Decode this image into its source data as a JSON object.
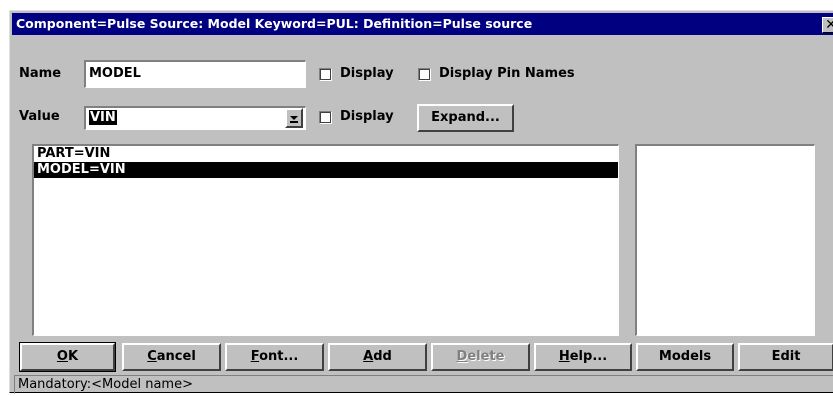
{
  "window": {
    "title": "Component=Pulse Source: Model Keyword=PUL: Definition=Pulse source",
    "close_glyph": "✕"
  },
  "name_row": {
    "label": "Name",
    "value": "MODEL",
    "display_label": "Display",
    "display_checked": false,
    "pin_names_label": "Display Pin Names",
    "pin_names_checked": false
  },
  "value_row": {
    "label": "Value",
    "value": "VIN",
    "display_label": "Display",
    "display_checked": false,
    "expand_label": "Expand..."
  },
  "attributes": [
    {
      "text": "PART=VIN",
      "selected": false
    },
    {
      "text": "MODEL=VIN",
      "selected": true
    }
  ],
  "buttons": {
    "ok": {
      "pre": "",
      "ul": "O",
      "post": "K"
    },
    "cancel": {
      "pre": "",
      "ul": "C",
      "post": "ancel"
    },
    "font": {
      "pre": "",
      "ul": "F",
      "post": "ont..."
    },
    "add": {
      "pre": "",
      "ul": "A",
      "post": "dd"
    },
    "delete": {
      "pre": "",
      "ul": "D",
      "post": "elete"
    },
    "help": {
      "pre": "",
      "ul": "H",
      "post": "elp..."
    },
    "models": "Models",
    "edit": "Edit"
  },
  "status": "Mandatory:<Model name>",
  "colors": {
    "titlebar": "#000080",
    "face": "#c0c0c0",
    "selection": "#000000"
  }
}
